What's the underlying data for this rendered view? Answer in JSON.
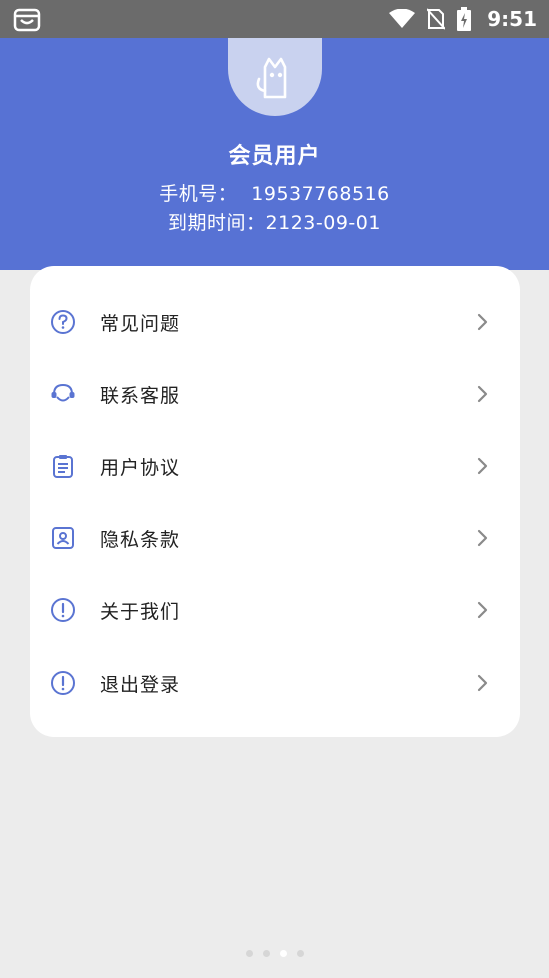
{
  "status_bar": {
    "time": "9:51",
    "icons": [
      "store-icon",
      "wifi-icon",
      "no-sim-icon",
      "battery-charging-icon"
    ]
  },
  "profile": {
    "avatar_icon": "cat-icon",
    "name": "会员用户",
    "phone_label": "手机号：",
    "phone_value": "19537768516",
    "expiry_label": "到期时间：",
    "expiry_value": "2123-09-01"
  },
  "menu": {
    "items": [
      {
        "label": "常见问题",
        "icon": "question-icon"
      },
      {
        "label": "联系客服",
        "icon": "headset-icon"
      },
      {
        "label": "用户协议",
        "icon": "clipboard-icon"
      },
      {
        "label": "隐私条款",
        "icon": "privacy-icon"
      },
      {
        "label": "关于我们",
        "icon": "info-icon"
      },
      {
        "label": "退出登录",
        "icon": "info-icon"
      }
    ]
  },
  "pager": {
    "count": 4,
    "active_index": 2
  },
  "colors": {
    "header": "#5772d4",
    "accent_icon": "#5a74d2",
    "background": "#ececec",
    "status_bar": "#6b6b6b"
  }
}
